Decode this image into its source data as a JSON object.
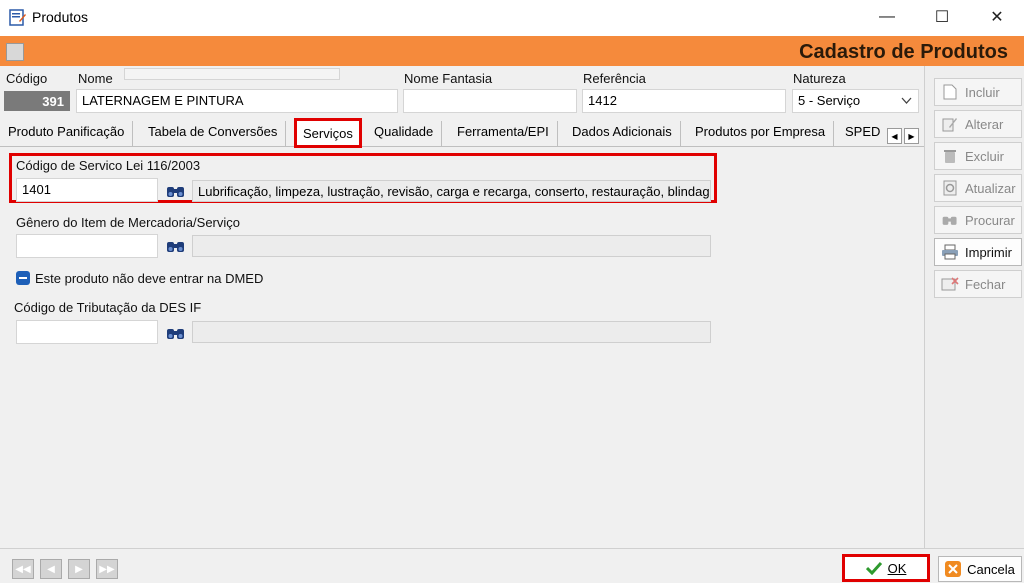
{
  "window": {
    "title": "Produtos",
    "minimize": "—",
    "maximize": "☐",
    "close": "✕"
  },
  "header": {
    "title": "Cadastro de Produtos",
    "accent": "#f58a3c"
  },
  "fields": {
    "codigo_label": "Código",
    "codigo_value": "391",
    "nome_label": "Nome",
    "nome_value": "LATERNAGEM E PINTURA",
    "nome_fantasia_label": "Nome Fantasia",
    "nome_fantasia_value": "",
    "referencia_label": "Referência",
    "referencia_value": "1412",
    "natureza_label": "Natureza",
    "natureza_value": "5 - Serviço"
  },
  "tabs": [
    {
      "label": "Produto Panificação"
    },
    {
      "label": "Tabela de Conversões"
    },
    {
      "label": "Serviços",
      "active": true
    },
    {
      "label": "Qualidade"
    },
    {
      "label": "Ferramenta/EPI"
    },
    {
      "label": "Dados Adicionais"
    },
    {
      "label": "Produtos por Empresa"
    },
    {
      "label": "SPED"
    }
  ],
  "servicos": {
    "codigo_servico_label": "Código de Servico Lei 116/2003",
    "codigo_servico_value": "1401",
    "codigo_servico_desc": "Lubrificação, limpeza, lustração, revisão, carga e recarga, conserto, restauração, blindagem",
    "genero_label": "Gênero do Item de Mercadoria/Serviço",
    "genero_value": "",
    "genero_desc": "",
    "dmed_label": "Este produto não deve entrar na DMED",
    "des_if_label": "Código de Tributação da DES IF",
    "des_if_value": "",
    "des_if_desc": ""
  },
  "side_buttons": [
    {
      "label": "Incluir",
      "icon": "document-icon",
      "enabled": false
    },
    {
      "label": "Alterar",
      "icon": "edit-icon",
      "enabled": false
    },
    {
      "label": "Excluir",
      "icon": "trash-icon",
      "enabled": false
    },
    {
      "label": "Atualizar",
      "icon": "refresh-icon",
      "enabled": false
    },
    {
      "label": "Procurar",
      "icon": "binoculars-icon",
      "enabled": false
    },
    {
      "label": "Imprimir",
      "icon": "printer-icon",
      "enabled": true
    },
    {
      "label": "Fechar",
      "icon": "close-form-icon",
      "enabled": false
    }
  ],
  "bottom": {
    "ok_label": "OK",
    "cancel_label": "Cancela"
  }
}
